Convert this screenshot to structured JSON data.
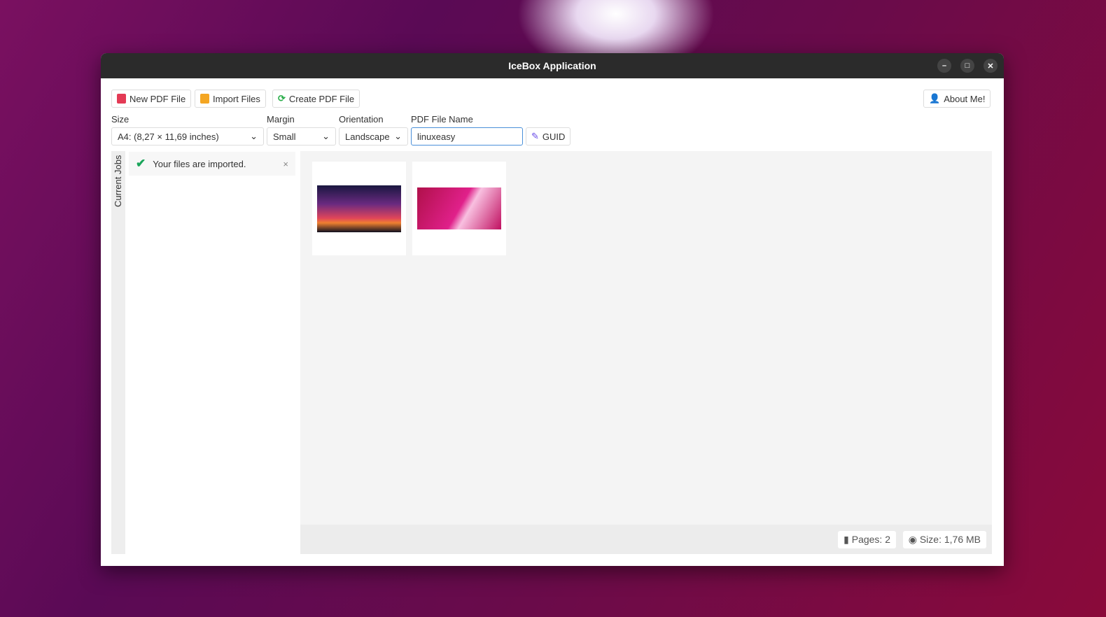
{
  "window": {
    "title": "IceBox Application"
  },
  "toolbar": {
    "new_pdf": "New PDF File",
    "import": "Import Files",
    "create": "Create PDF File",
    "about": "About Me!"
  },
  "form": {
    "size_label": "Size",
    "size_value": "A4: (8,27 × 11,69 inches)",
    "margin_label": "Margin",
    "margin_value": "Small",
    "orientation_label": "Orientation",
    "orientation_value": "Landscape",
    "filename_label": "PDF File Name",
    "filename_value": "linuxeasy",
    "guid": "GUID"
  },
  "sidebar": {
    "tab": "Current Jobs",
    "notification": "Your files are imported."
  },
  "status": {
    "pages": "Pages: 2",
    "size": "Size: 1,76 MB"
  }
}
